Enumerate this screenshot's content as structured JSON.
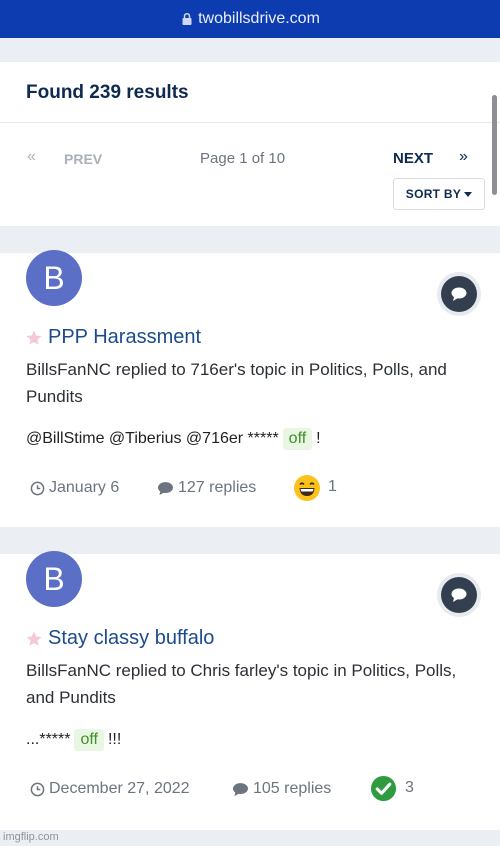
{
  "browser": {
    "url": "twobillsdrive.com"
  },
  "results": {
    "title": "Found 239 results"
  },
  "pagination": {
    "first_glyph": "«",
    "prev_label": "PREV",
    "page_info": "Page 1 of 10",
    "next_label": "NEXT",
    "last_glyph": "»",
    "sort_label": "SORT BY"
  },
  "posts": [
    {
      "avatar_letter": "B",
      "title": "PPP Harassment",
      "meta": "BillsFanNC replied to 716er's topic in Politics, Polls, and Pundits",
      "snippet_before": "@BillStime @Tiberius @716er *****",
      "snippet_highlight": "off",
      "snippet_after": "!",
      "date": "January 6",
      "replies": "127 replies",
      "reaction_icon": "laughing-emoji-icon",
      "reaction_count": "1"
    },
    {
      "avatar_letter": "B",
      "title": "Stay classy buffalo",
      "meta": "BillsFanNC replied to Chris farley's topic in Politics, Polls, and Pundits",
      "snippet_before": "...*****",
      "snippet_highlight": "off",
      "snippet_after": "!!!",
      "date": "December 27, 2022",
      "replies": "105 replies",
      "reaction_icon": "green-check-icon",
      "reaction_count": "3"
    }
  ],
  "watermark": "imgflip.com",
  "colors": {
    "url_bar": "#0d3bb0",
    "title_link": "#1c4b8c",
    "avatar": "#5b6fc6",
    "highlight_bg": "#e9f7e2",
    "highlight_text": "#3f8f2c"
  }
}
